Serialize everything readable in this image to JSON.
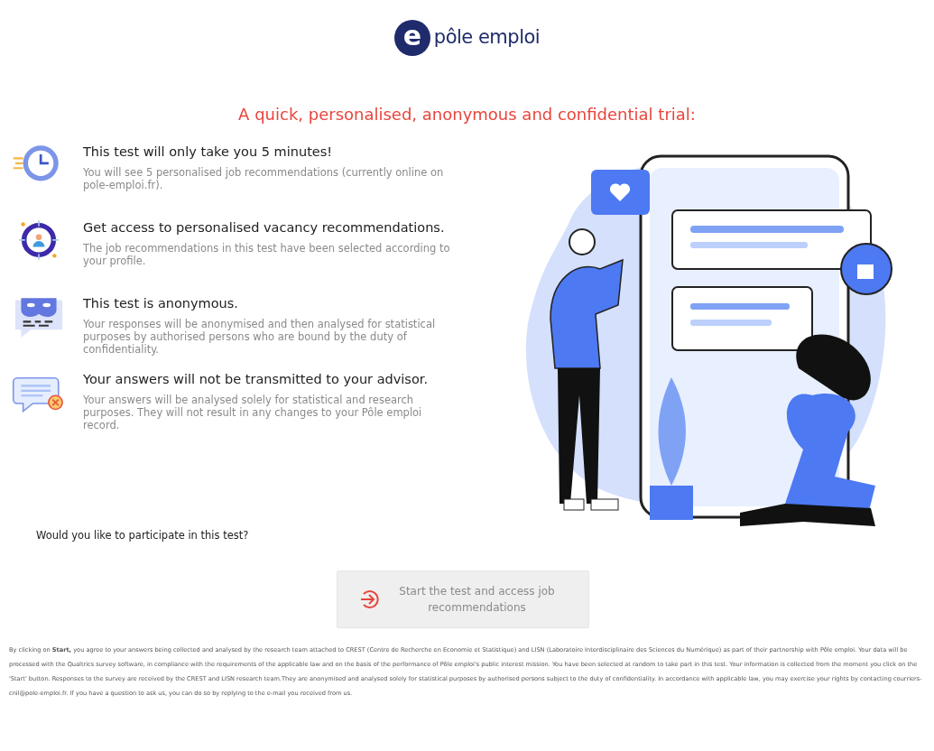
{
  "logo": {
    "mark": "e",
    "text": "pôle emploi"
  },
  "headline": "A quick, personalised, anonymous and confidential trial:",
  "features": [
    {
      "kind": "clock",
      "title": "This test will only take you 5 minutes!",
      "text": "You will see 5 personalised job recommendations (currently online on pole-emploi.fr)."
    },
    {
      "kind": "target",
      "title": "Get access to personalised vacancy recommendations.",
      "text": "The job recommendations in this test have been selected according to your profile."
    },
    {
      "kind": "mask",
      "title": "This test is anonymous.",
      "text": "Your responses will be anonymised and then analysed for statistical purposes by authorised persons who are bound by the duty of confidentiality."
    },
    {
      "kind": "chat",
      "title": "Your answers will not be transmitted to your advisor.",
      "text": "Your answers will be analysed solely for statistical and research purposes. They will not result in any changes to your Pôle emploi record."
    }
  ],
  "question": "Would you like to participate in this test?",
  "start_button": "Start the test and access job recommendations",
  "footer": "By clicking on **Start,** you agree to your answers being collected and analysed by the research team attached to CREST (Centre de Recherche en Economie et Statistique) and LISN (Laboratoire Interdisciplinaire des Sciences du Numérique) as part of their partnership with Pôle emploi. Your data will be processed with the Qualtrics survey software, in compliance with the requirements of the applicable law and on the basis of the performance of Pôle emploi's public interest mission. You have been selected at random to take part in this test. Your information is collected from the moment you click on the 'Start' button. Responses to the survey are received by the CREST and LISN research team.They are anonymised and analysed solely for statistical purposes by authorised persons subject to the duty of confidentiality. In accordance with applicable law, you may exercise your rights by contacting courriers-cnil@pole-emploi.fr. If you have a question to ask us, you can do so by replying to the e-mail you received from us."
}
